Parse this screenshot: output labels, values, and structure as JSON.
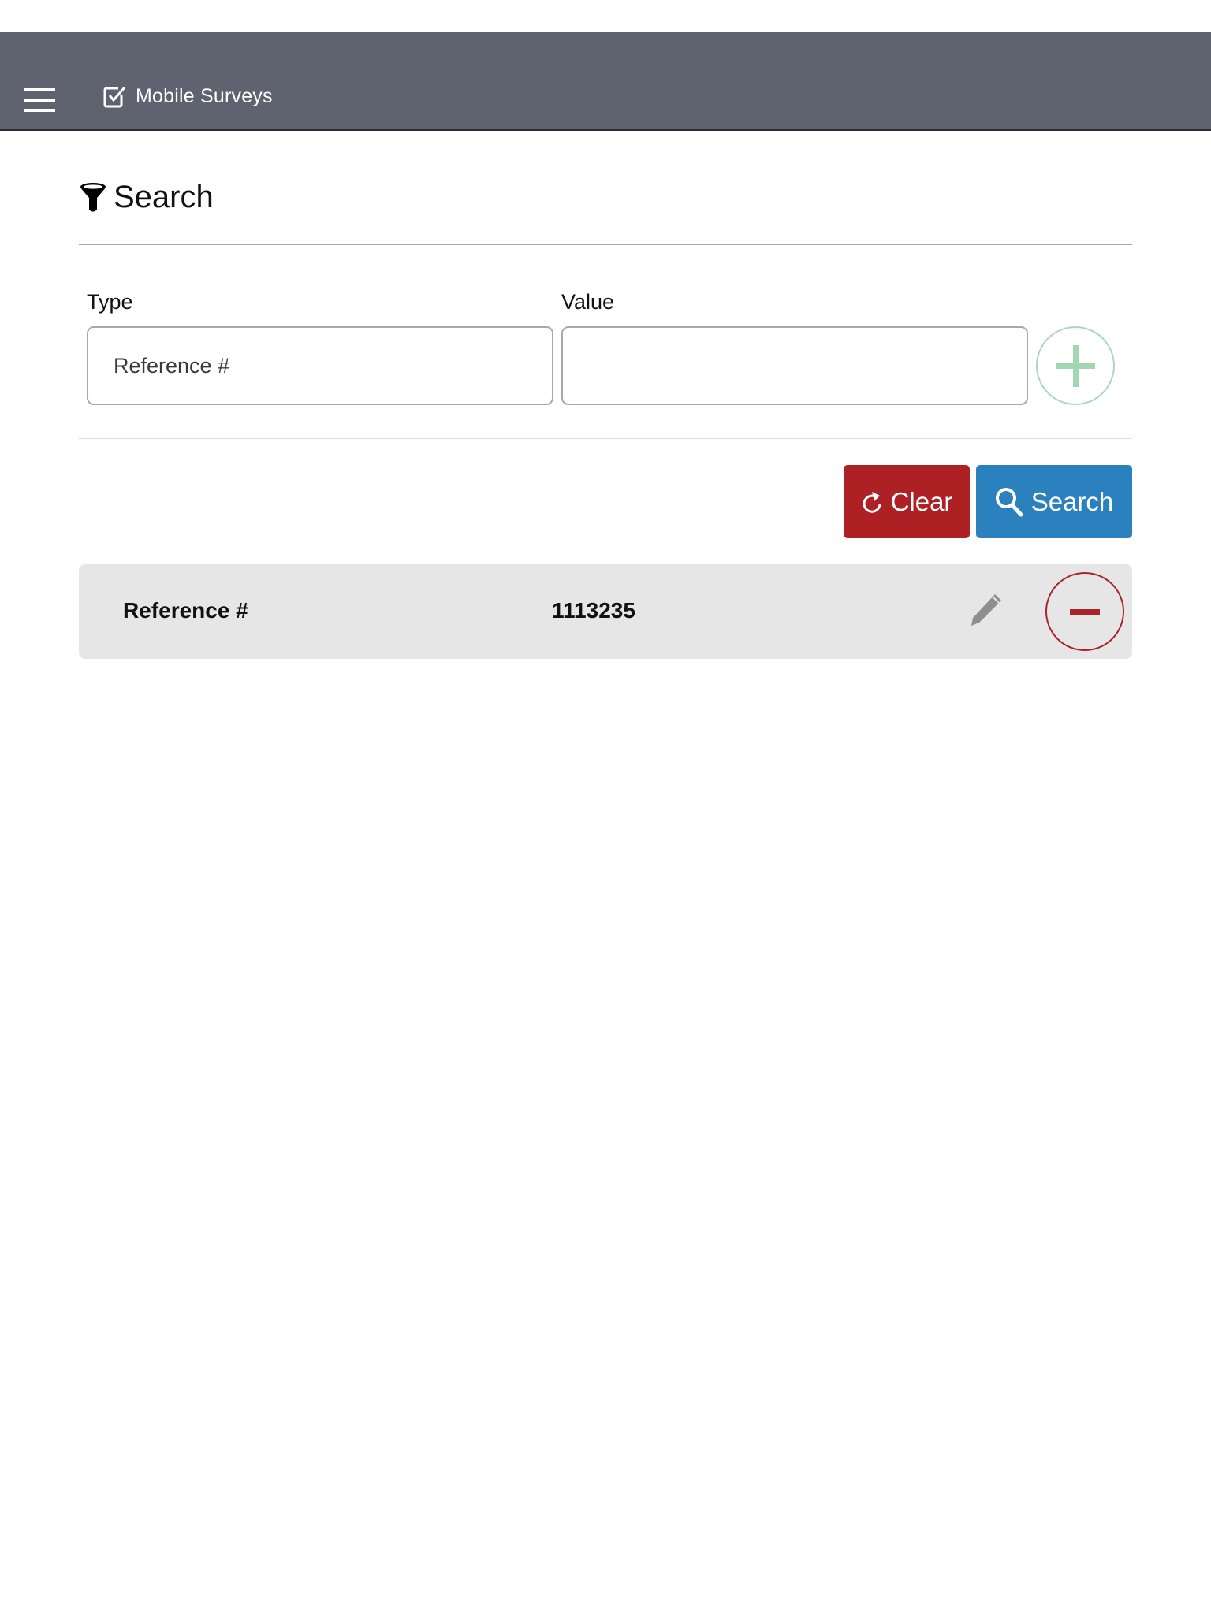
{
  "navbar": {
    "menu_icon": "hamburger-menu-icon",
    "brand_icon": "checkbox-checked-icon",
    "brand_label": "Mobile Surveys",
    "background_color": "#5f6370"
  },
  "search": {
    "heading_icon": "filter-funnel-icon",
    "title": "Search",
    "type_label": "Type",
    "type_value": "Reference #",
    "value_label": "Value",
    "value_value": "",
    "value_placeholder": "",
    "add_icon": "plus-icon"
  },
  "actions": {
    "clear_label": "Clear",
    "clear_icon": "refresh-icon",
    "clear_color": "#ad2024",
    "search_label": "Search",
    "search_icon": "magnifier-icon",
    "search_color": "#2b80be"
  },
  "filters": [
    {
      "type": "Reference #",
      "value": "1113235",
      "edit_icon": "pencil-icon",
      "remove_icon": "minus-icon"
    }
  ]
}
